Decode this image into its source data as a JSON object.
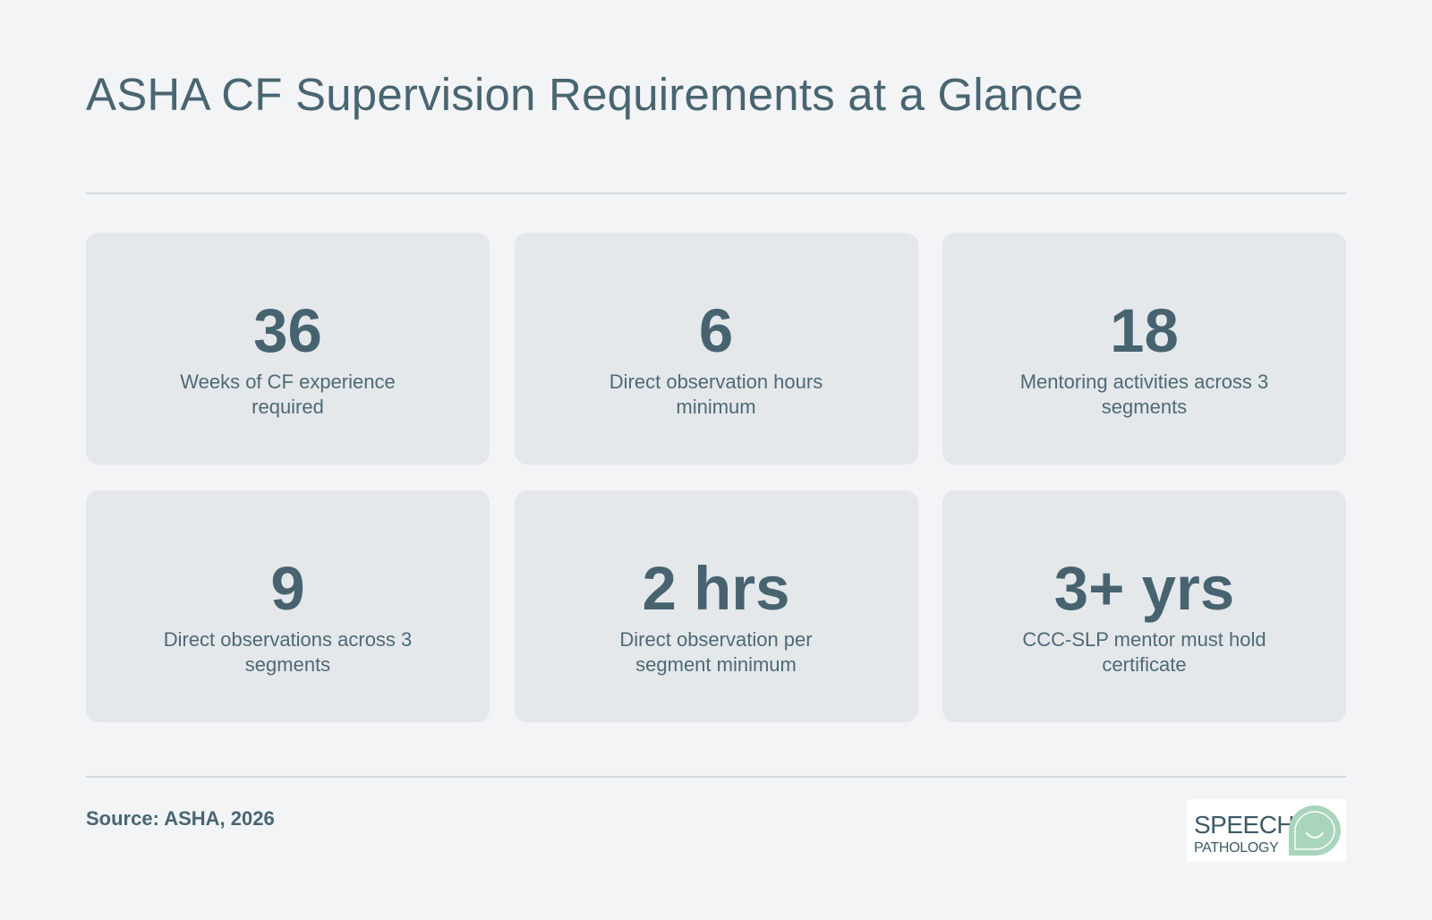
{
  "header": {
    "title": "ASHA CF Supervision Requirements at a Glance"
  },
  "stats": [
    {
      "value": "36",
      "label": "Weeks of CF experience required"
    },
    {
      "value": "6",
      "label": "Direct observation hours minimum"
    },
    {
      "value": "18",
      "label": "Mentoring activities across 3 segments"
    },
    {
      "value": "9",
      "label": "Direct observations across 3 segments"
    },
    {
      "value": "2 hrs",
      "label": "Direct observation per segment minimum"
    },
    {
      "value": "3+ yrs",
      "label": "CCC-SLP mentor must hold certificate"
    }
  ],
  "footer": {
    "source": "Source: ASHA, 2026",
    "logo_line1": "SPEECH",
    "logo_line2": "PATHOLOGY"
  },
  "colors": {
    "background": "#f2f4f6",
    "card": "#e4e8eb",
    "text": "#4a6572",
    "logo_accent": "#a9d5bd"
  },
  "icons": {
    "logo": "speech-bubble-smile-icon"
  }
}
